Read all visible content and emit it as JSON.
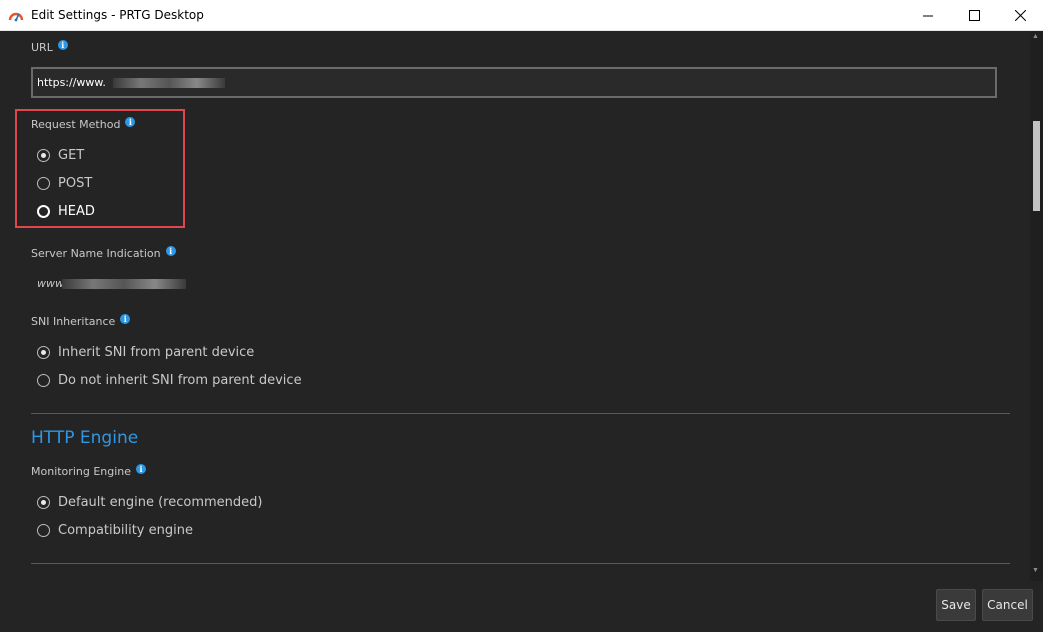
{
  "window": {
    "title": "Edit Settings - PRTG Desktop"
  },
  "url": {
    "label": "URL",
    "value": "https://www."
  },
  "request_method": {
    "label": "Request Method",
    "options": [
      {
        "label": "GET",
        "checked": true
      },
      {
        "label": "POST",
        "checked": false
      },
      {
        "label": "HEAD",
        "checked": false
      }
    ]
  },
  "sni": {
    "label": "Server Name Indication",
    "value": "www."
  },
  "sni_inheritance": {
    "label": "SNI Inheritance",
    "options": [
      {
        "label": "Inherit SNI from parent device",
        "checked": true
      },
      {
        "label": "Do not inherit SNI from parent device",
        "checked": false
      }
    ]
  },
  "http_engine": {
    "section_title": "HTTP Engine",
    "label": "Monitoring Engine",
    "options": [
      {
        "label": "Default engine (recommended)",
        "checked": true
      },
      {
        "label": "Compatibility engine",
        "checked": false
      }
    ]
  },
  "footer": {
    "save_label": "Save",
    "cancel_label": "Cancel"
  },
  "colors": {
    "background": "#242424",
    "accent": "#2d98e5",
    "highlight_border": "#e0464b"
  }
}
